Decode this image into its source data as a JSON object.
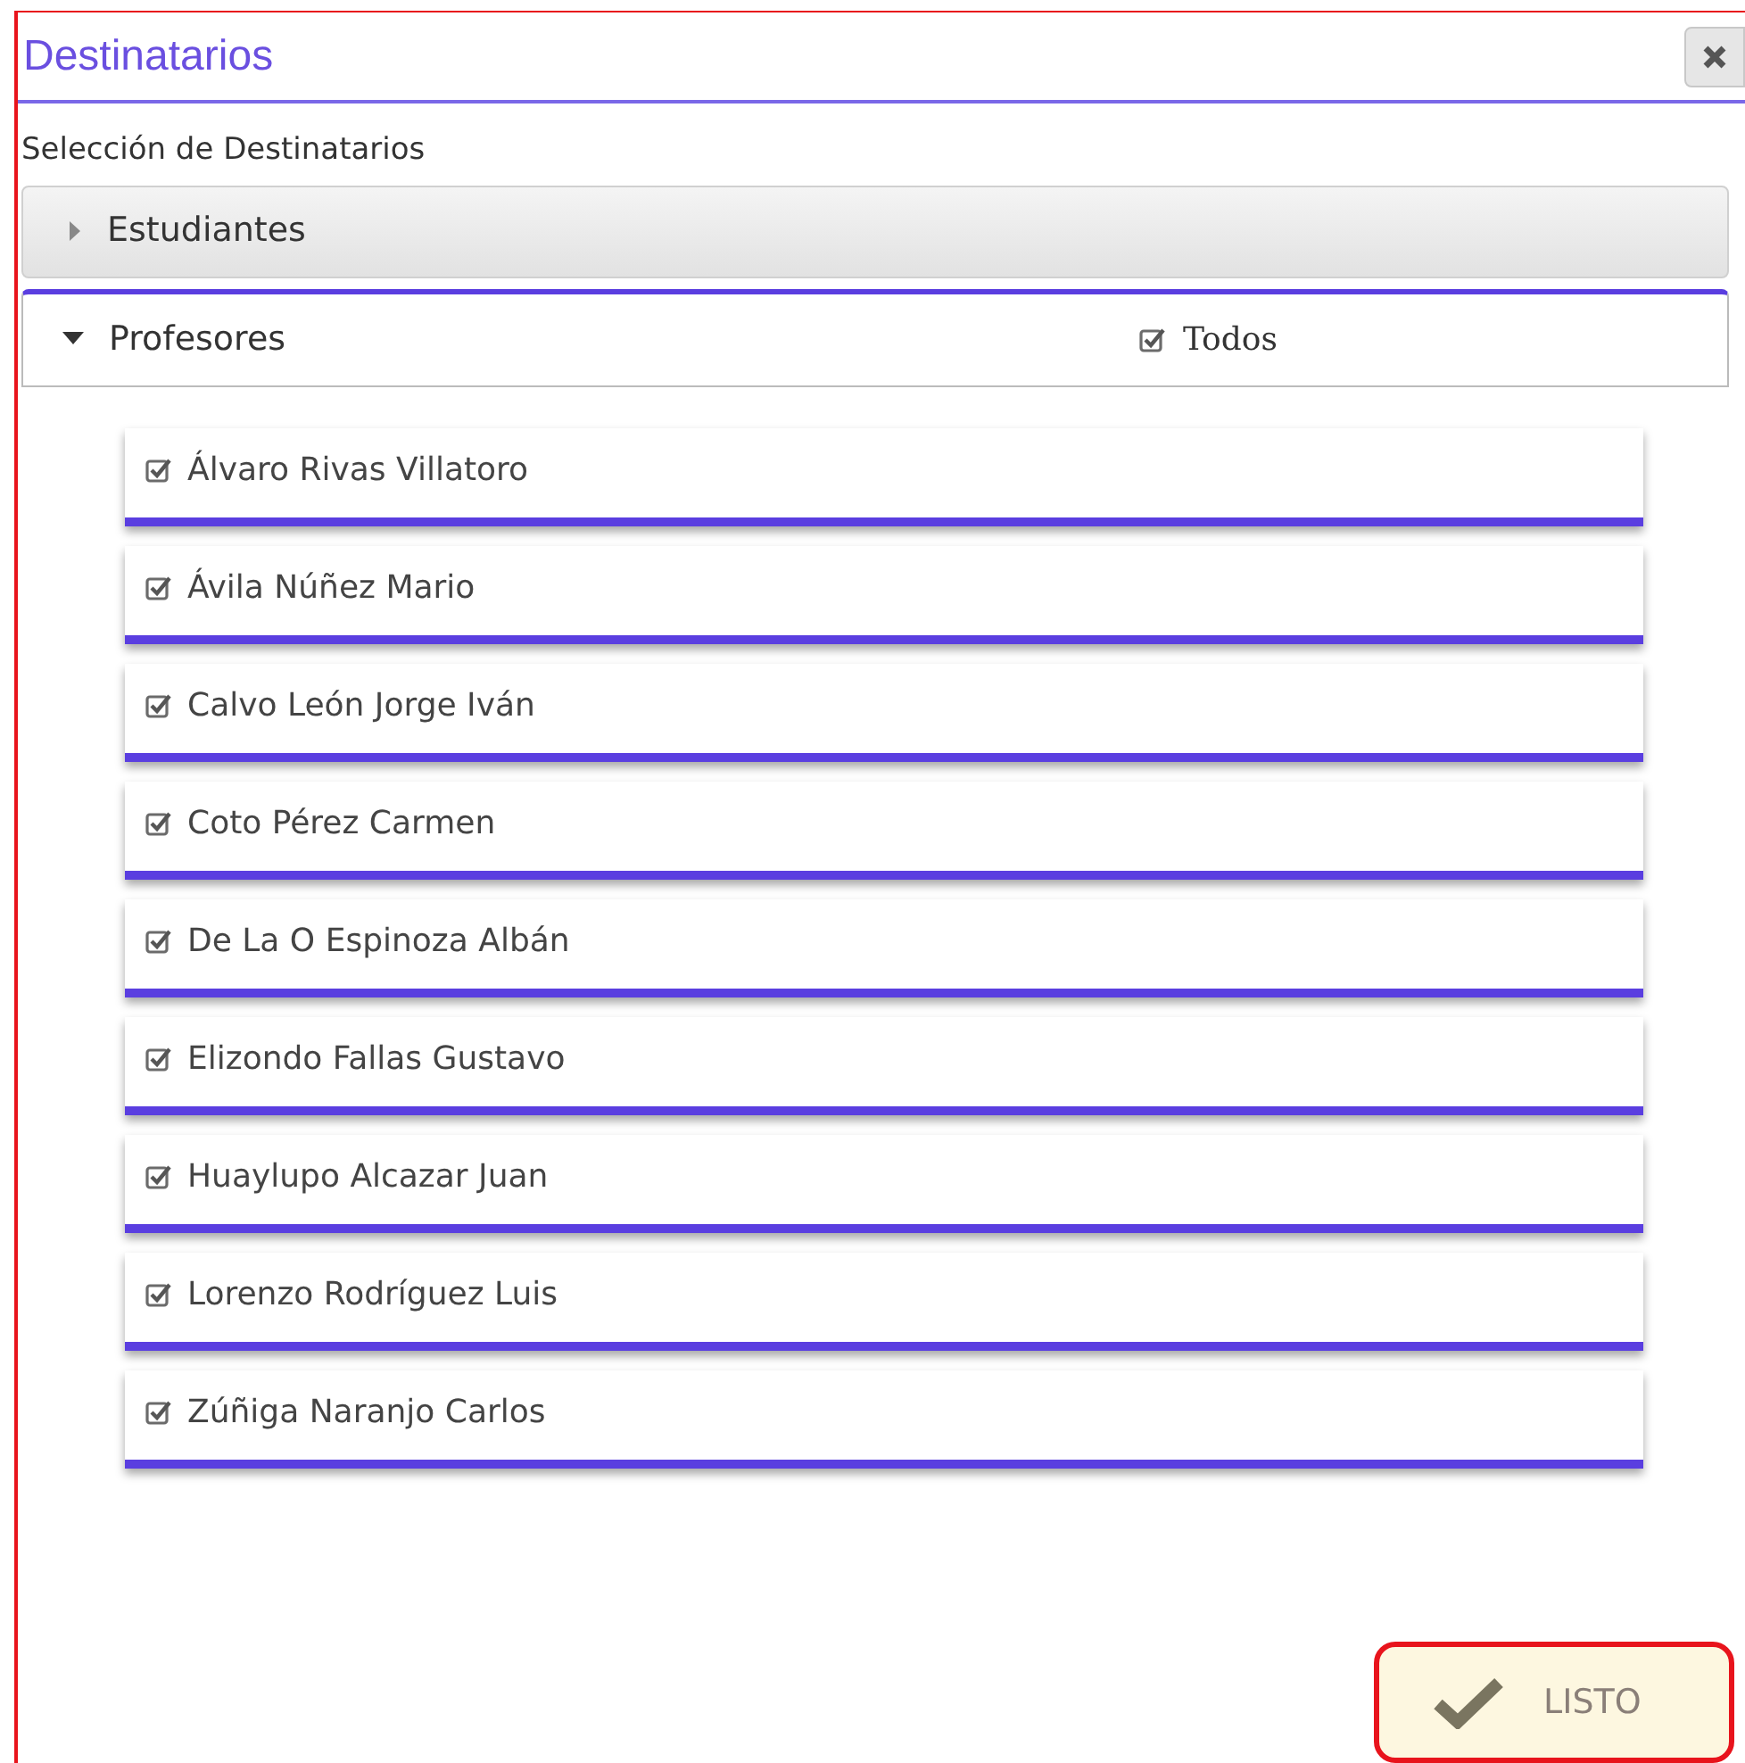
{
  "dialog": {
    "title": "Destinatarios",
    "subtitle": "Selección de Destinatarios"
  },
  "sections": [
    {
      "label": "Estudiantes",
      "expanded": false
    },
    {
      "label": "Profesores",
      "expanded": true,
      "select_all": {
        "label": "Todos",
        "checked": true
      },
      "items": [
        {
          "label": "Álvaro Rivas Villatoro",
          "checked": true
        },
        {
          "label": "Ávila Núñez Mario",
          "checked": true
        },
        {
          "label": "Calvo León Jorge Iván",
          "checked": true
        },
        {
          "label": "Coto Pérez Carmen",
          "checked": true
        },
        {
          "label": "De La O Espinoza Albán",
          "checked": true
        },
        {
          "label": "Elizondo Fallas Gustavo",
          "checked": true
        },
        {
          "label": "Huaylupo Alcazar Juan",
          "checked": true
        },
        {
          "label": "Lorenzo Rodríguez Luis",
          "checked": true
        },
        {
          "label": "Zúñiga Naranjo Carlos",
          "checked": true
        }
      ]
    }
  ],
  "done_button": {
    "label": "LISTO"
  }
}
